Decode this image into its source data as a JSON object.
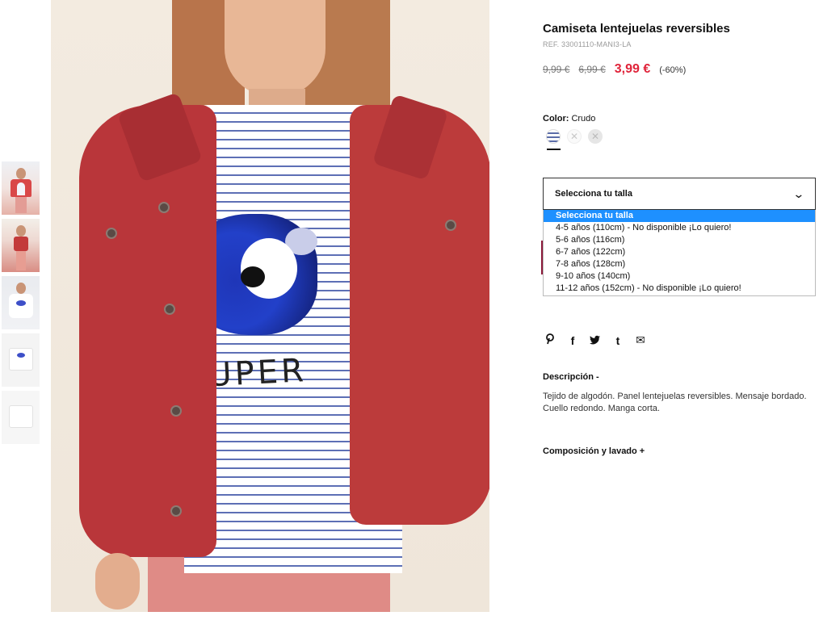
{
  "product": {
    "title": "Camiseta lentejuelas reversibles",
    "ref": "REF. 33001110-MANI3-LA",
    "price_original_1": "9,99 €",
    "price_original_2": "6,99 €",
    "price_current": "3,99 €",
    "discount": "(-60%)"
  },
  "color": {
    "label": "Color:",
    "value": "Crudo",
    "swatches": [
      {
        "name": "crudo-striped",
        "selected": true
      },
      {
        "name": "unavailable",
        "symbol": "✕"
      },
      {
        "name": "unavailable",
        "symbol": "✕"
      }
    ]
  },
  "size": {
    "select_label": "Selecciona tu talla",
    "options": [
      "Selecciona tu talla",
      "4-5 años (110cm) - No disponible ¡Lo quiero!",
      "5-6 años (116cm)",
      "6-7 años (122cm)",
      "7-8 años (128cm)",
      "9-10 años (140cm)",
      "11-12 años (152cm) - No disponible ¡Lo quiero!"
    ],
    "selected_index": 0
  },
  "share_icons": [
    {
      "name": "pinterest-icon",
      "glyph": "℗"
    },
    {
      "name": "facebook-icon",
      "glyph": "f"
    },
    {
      "name": "twitter-icon",
      "glyph": "🐦"
    },
    {
      "name": "tumblr-icon",
      "glyph": "t"
    },
    {
      "name": "email-icon",
      "glyph": "✉"
    }
  ],
  "description": {
    "heading": "Descripción  -",
    "text": "Tejido de algodón. Panel lentejuelas reversibles. Mensaje bordado. Cuello redondo. Manga corta."
  },
  "composition": {
    "heading": "Composición y lavado  +"
  },
  "main_image": {
    "print_text": "SUPER"
  },
  "thumbnails": [
    "thumb-1",
    "thumb-2",
    "thumb-3",
    "thumb-4",
    "thumb-5"
  ],
  "colors": {
    "sale": "#e0243a",
    "selected_option": "#1e90ff"
  }
}
